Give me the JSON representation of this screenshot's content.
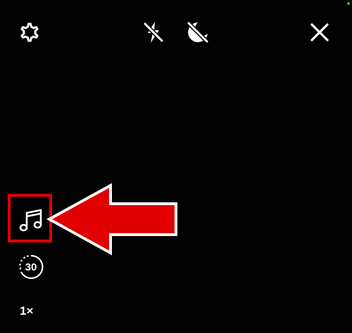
{
  "toolbar": {
    "settings_icon": "gear-icon",
    "flash_icon": "flash-off-icon",
    "night_icon": "night-mode-off-icon",
    "close_icon": "close-icon"
  },
  "side_controls": {
    "music_icon": "music-note-icon",
    "timer_label": "30",
    "speed_label": "1×"
  },
  "annotation": {
    "color": "#e00000",
    "arrow_direction": "left"
  }
}
